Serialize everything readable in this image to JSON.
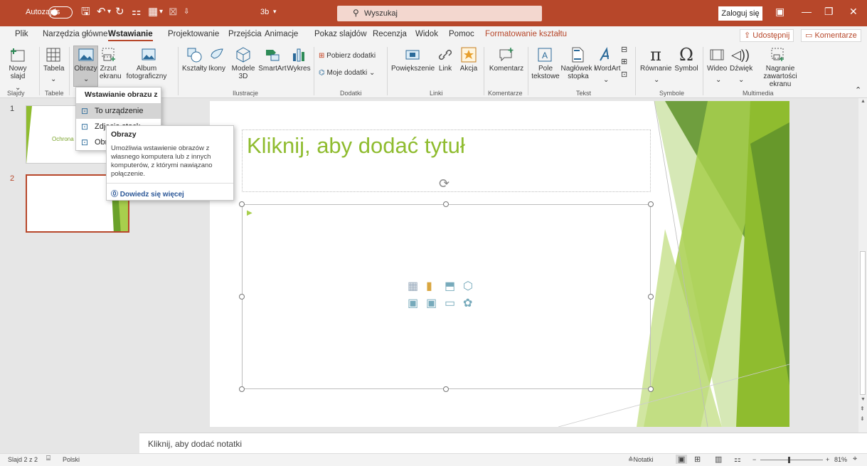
{
  "titlebar": {
    "autosave_label": "Autozapis",
    "doc_name": "3b",
    "search_placeholder": "Wyszukaj",
    "login_label": "Zaloguj się"
  },
  "tabs": [
    "Plik",
    "Narzędzia główne",
    "Wstawianie",
    "Projektowanie",
    "Przejścia",
    "Animacje",
    "Pokaz slajdów",
    "Recenzja",
    "Widok",
    "Pomoc",
    "Formatowanie kształtu"
  ],
  "active_tab": "Wstawianie",
  "share_label": "Udostępnij",
  "comments_label": "Komentarze",
  "ribbon": {
    "new_slide": "Nowy slajd",
    "table": "Tabela",
    "images": "Obrazy",
    "screenshot": "Zrzut ekranu",
    "album": "Album fotograficzny",
    "shapes": "Kształty",
    "icons": "Ikony",
    "models3d": "Modele 3D",
    "smartart": "SmartArt",
    "chart": "Wykres",
    "get_addins": "Pobierz dodatki",
    "my_addins": "Moje dodatki",
    "zoom": "Powiększenie",
    "link": "Link",
    "action": "Akcja",
    "comment": "Komentarz",
    "textbox": "Pole tekstowe",
    "header_footer": "Nagłówek i stopka",
    "wordart": "WordArt",
    "equation": "Równanie",
    "symbol": "Symbol",
    "video": "Wideo",
    "audio": "Dźwięk",
    "screen_recording": "Nagranie zawartości ekranu",
    "groups": {
      "slides": "Slajdy",
      "tables": "Tabele",
      "illustrations": "Ilustracje",
      "addins": "Dodatki",
      "links": "Linki",
      "comments": "Komentarze",
      "text": "Tekst",
      "symbols": "Symbole",
      "multimedia": "Multimedia"
    }
  },
  "dropdown": {
    "header": "Wstawianie obrazu z",
    "items": [
      "To urządzenie",
      "Zdjęcia stock",
      "Obrazy online"
    ]
  },
  "tooltip": {
    "title": "Obrazy",
    "body": "Umożliwia wstawienie obrazów z własnego komputera lub z innych komputerów, z którymi nawiązano połączenie.",
    "link": "Dowiedz się więcej"
  },
  "thumbnails": [
    {
      "number": "1",
      "caption": "Ochrona"
    },
    {
      "number": "2",
      "caption": ""
    }
  ],
  "slide": {
    "title_placeholder": "Kliknij, aby dodać tytuł"
  },
  "notes_placeholder": "Kliknij, aby dodać notatki",
  "status": {
    "slide_info": "Slajd 2 z 2",
    "language": "Polski",
    "notes": "Notatki",
    "zoom": "81%"
  },
  "colors": {
    "accent": "#b7472a",
    "title_green": "#8fbc2f",
    "link_blue": "#2b5797"
  }
}
